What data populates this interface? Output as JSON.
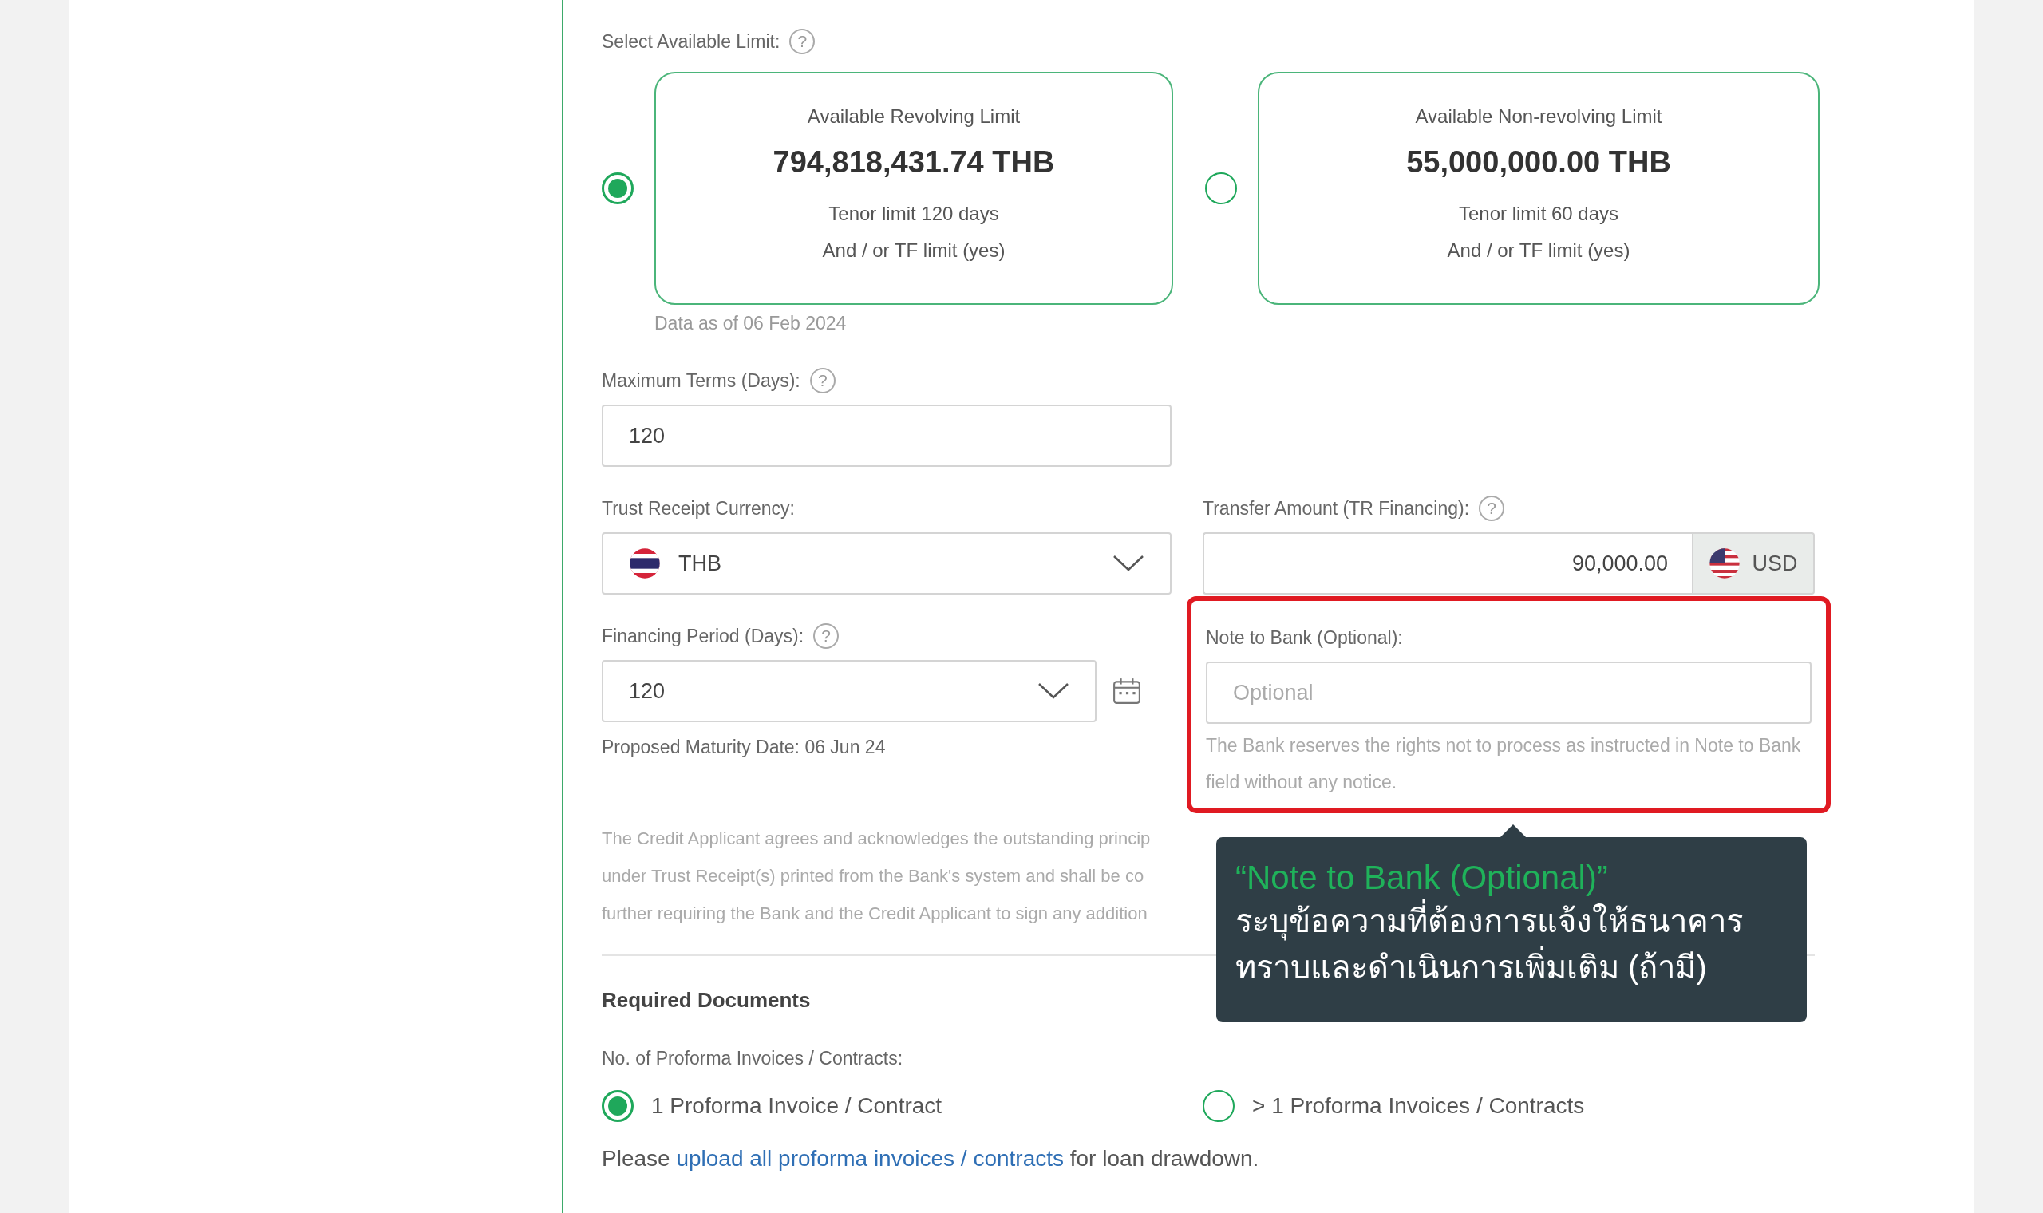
{
  "limit_section": {
    "label": "Select Available Limit:",
    "help": "?",
    "options": [
      {
        "title": "Available Revolving Limit",
        "amount": "794,818,431.74 THB",
        "tenor": "Tenor limit 120 days",
        "tf": "And / or TF limit (yes)",
        "selected": true
      },
      {
        "title": "Available Non-revolving Limit",
        "amount": "55,000,000.00 THB",
        "tenor": "Tenor limit 60 days",
        "tf": "And / or TF limit (yes)",
        "selected": false
      }
    ],
    "data_as_of": "Data as of 06 Feb 2024"
  },
  "maximum_terms": {
    "label": "Maximum Terms (Days):",
    "help": "?",
    "value": "120"
  },
  "trust_receipt_currency": {
    "label": "Trust Receipt Currency:",
    "value": "THB"
  },
  "transfer_amount": {
    "label": "Transfer Amount (TR Financing):",
    "help": "?",
    "value": "90,000.00",
    "currency": "USD"
  },
  "financing_period": {
    "label": "Financing Period (Days):",
    "help": "?",
    "value": "120",
    "maturity": "Proposed Maturity Date: 06 Jun 24"
  },
  "note_to_bank": {
    "label": "Note to Bank (Optional):",
    "placeholder": "Optional",
    "hint": "The Bank reserves the rights not to process as instructed in Note to Bank field without any notice.",
    "highlighted": true
  },
  "disclaimer_lines": [
    "The Credit Applicant agrees and acknowledges the outstanding princip",
    "under Trust Receipt(s) printed from the Bank's system and shall be co",
    "further requiring the Bank and the Credit Applicant to sign any addition"
  ],
  "required_documents": {
    "title": "Required Documents",
    "count_label": "No. of Proforma Invoices / Contracts:",
    "options": [
      {
        "label": "1 Proforma Invoice / Contract",
        "selected": true
      },
      {
        "label": "> 1 Proforma Invoices / Contracts",
        "selected": false
      }
    ],
    "upload_prefix": "Please",
    "upload_link": "upload all proforma invoices / contracts",
    "upload_suffix": "for loan drawdown."
  },
  "tooltip": {
    "title": "“Note to Bank (Optional)”",
    "body": "ระบุข้อความที่ต้องการแจ้งให้ธนาคาร\nทราบและดำเนินการเพิ่มเติม (ถ้ามี)"
  }
}
